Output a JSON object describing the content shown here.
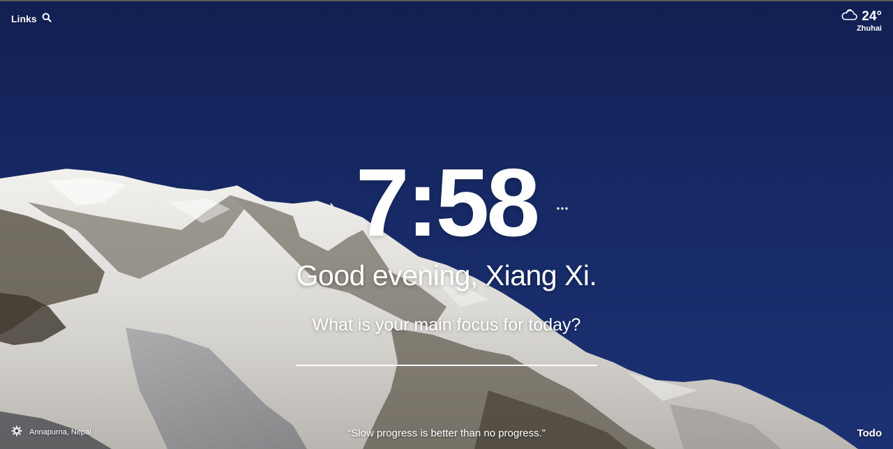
{
  "top_left": {
    "links_label": "Links",
    "search_icon": "search-icon"
  },
  "weather": {
    "icon": "cloud-icon",
    "temperature": "24°",
    "city": "Zhuhai"
  },
  "clock": {
    "time": "7:58"
  },
  "greeting": {
    "text": "Good evening, Xiang Xi."
  },
  "focus": {
    "question": "What is your main focus for today?",
    "value": ""
  },
  "bottom": {
    "settings_icon": "gear-icon",
    "photo_location": "Annapurna, Nepal",
    "quote": "“Slow progress is better than no progress.”",
    "todo_label": "Todo"
  },
  "colors": {
    "sky": "#172a66",
    "text": "#ffffff"
  }
}
